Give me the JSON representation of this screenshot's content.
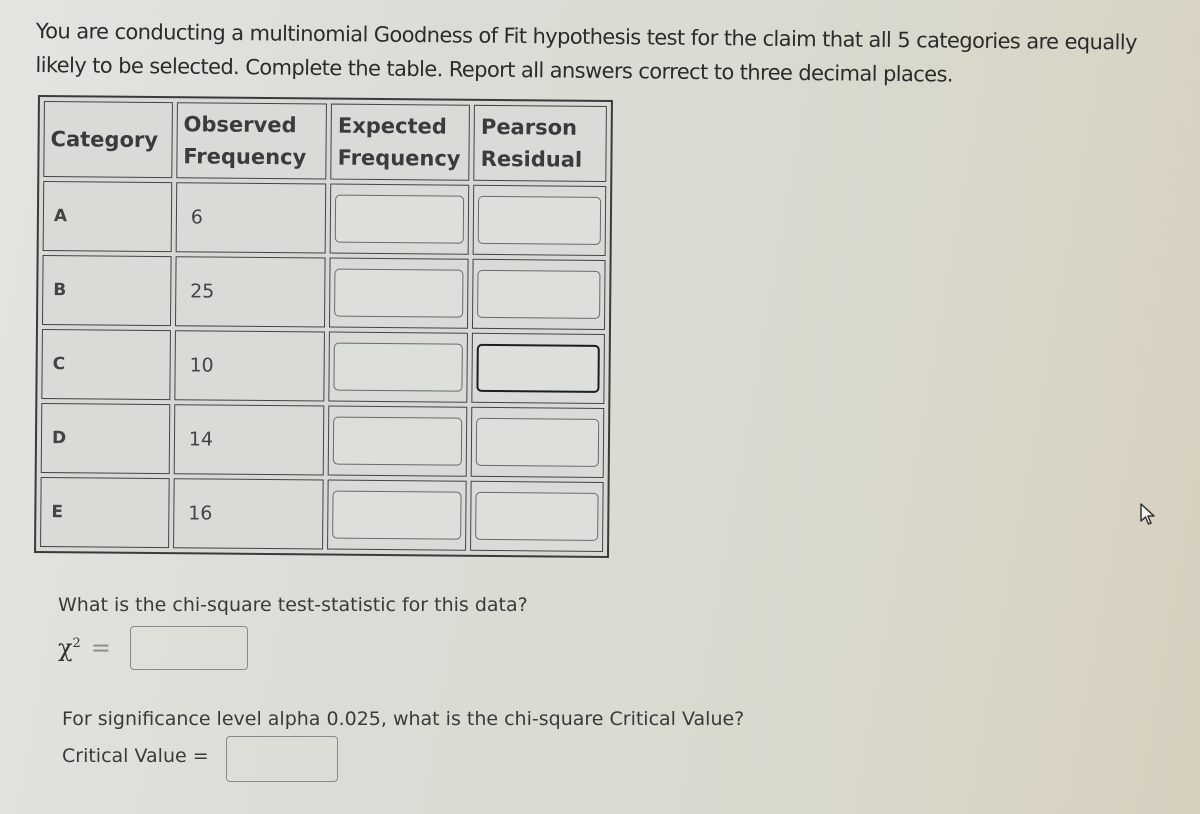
{
  "prompt": "You are conducting a multinomial Goodness of Fit hypothesis test for the claim that all 5 categories are equally likely to be selected. Complete the table. Report all answers correct to three decimal places.",
  "table": {
    "headers": [
      "Category",
      "Observed Frequency",
      "Expected Frequency",
      "Pearson Residual"
    ],
    "rows": [
      {
        "category": "A",
        "observed": "6",
        "expected": "",
        "residual": ""
      },
      {
        "category": "B",
        "observed": "25",
        "expected": "",
        "residual": ""
      },
      {
        "category": "C",
        "observed": "10",
        "expected": "",
        "residual": ""
      },
      {
        "category": "D",
        "observed": "14",
        "expected": "",
        "residual": ""
      },
      {
        "category": "E",
        "observed": "16",
        "expected": "",
        "residual": ""
      }
    ]
  },
  "test_statistic": {
    "question": "What is the chi-square test-statistic for this data?",
    "symbol": "χ",
    "exponent": "2",
    "equals": "=",
    "value": ""
  },
  "critical_value": {
    "question": "For significance level alpha 0.025, what is the chi-square Critical Value?",
    "label": "Critical Value =",
    "value": ""
  },
  "cursor_icon": "mouse-pointer-icon"
}
